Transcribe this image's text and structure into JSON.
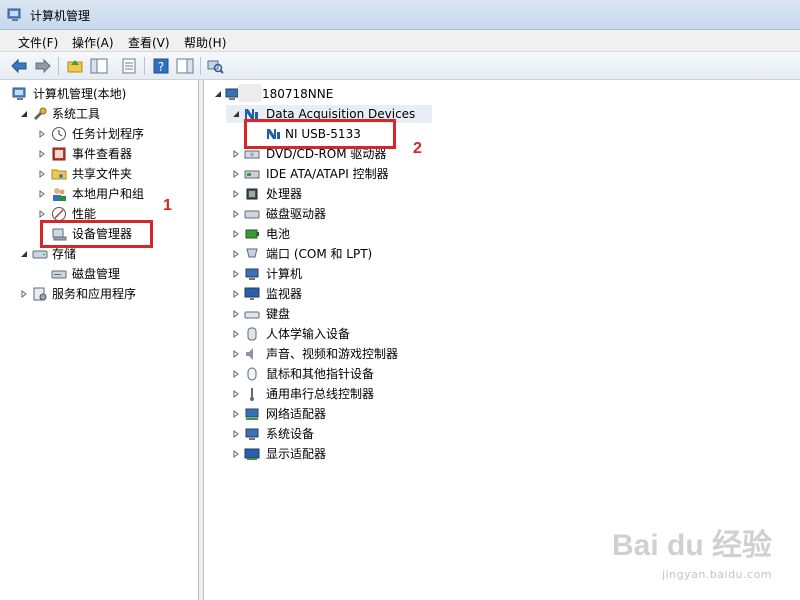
{
  "window": {
    "title": "计算机管理"
  },
  "menu": [
    {
      "label": "文件(F)"
    },
    {
      "label": "操作(A)"
    },
    {
      "label": "查看(V)"
    },
    {
      "label": "帮助(H)"
    }
  ],
  "toolbar": {
    "buttons": [
      "back-icon",
      "forward-icon",
      "up-folder-icon",
      "show-tree-icon",
      "properties-icon",
      "help-icon",
      "action-pane-icon",
      "scan-hardware-icon"
    ]
  },
  "left_tree": [
    {
      "label": "计算机管理(本地)",
      "icon": "computer-management-icon"
    },
    {
      "label": "系统工具",
      "icon": "system-tools-icon"
    },
    {
      "label": "任务计划程序",
      "icon": "task-scheduler-icon"
    },
    {
      "label": "事件查看器",
      "icon": "event-viewer-icon"
    },
    {
      "label": "共享文件夹",
      "icon": "shared-folders-icon"
    },
    {
      "label": "本地用户和组",
      "icon": "local-users-icon"
    },
    {
      "label": "性能",
      "icon": "performance-icon"
    },
    {
      "label": "设备管理器",
      "icon": "device-manager-icon"
    },
    {
      "label": "存储",
      "icon": "storage-icon"
    },
    {
      "label": "磁盘管理",
      "icon": "disk-management-icon"
    },
    {
      "label": "服务和应用程序",
      "icon": "services-icon"
    }
  ],
  "right_tree": {
    "root": {
      "label": "180718NNE",
      "icon": "computer-icon"
    },
    "category": {
      "label": "Data Acquisition Devices",
      "icon": "ni-icon"
    },
    "device": {
      "label": "NI USB-5133",
      "icon": "ni-icon"
    },
    "items": [
      {
        "label": "DVD/CD-ROM 驱动器",
        "icon": "dvd-drive-icon"
      },
      {
        "label": "IDE ATA/ATAPI 控制器",
        "icon": "ide-controller-icon"
      },
      {
        "label": "处理器",
        "icon": "processor-icon"
      },
      {
        "label": "磁盘驱动器",
        "icon": "disk-drive-icon"
      },
      {
        "label": "电池",
        "icon": "battery-icon"
      },
      {
        "label": "端口 (COM 和 LPT)",
        "icon": "port-icon"
      },
      {
        "label": "计算机",
        "icon": "computer-icon"
      },
      {
        "label": "监视器",
        "icon": "monitor-icon"
      },
      {
        "label": "键盘",
        "icon": "keyboard-icon"
      },
      {
        "label": "人体学输入设备",
        "icon": "hid-icon"
      },
      {
        "label": "声音、视频和游戏控制器",
        "icon": "sound-icon"
      },
      {
        "label": "鼠标和其他指针设备",
        "icon": "mouse-icon"
      },
      {
        "label": "通用串行总线控制器",
        "icon": "usb-icon"
      },
      {
        "label": "网络适配器",
        "icon": "network-adapter-icon"
      },
      {
        "label": "系统设备",
        "icon": "system-devices-icon"
      },
      {
        "label": "显示适配器",
        "icon": "display-adapter-icon"
      }
    ]
  },
  "annotations": {
    "callout1": "1",
    "callout2": "2",
    "accent": "#d4272b"
  },
  "watermark": {
    "main": "Bai du 经验",
    "sub": "jingyan.baidu.com"
  }
}
